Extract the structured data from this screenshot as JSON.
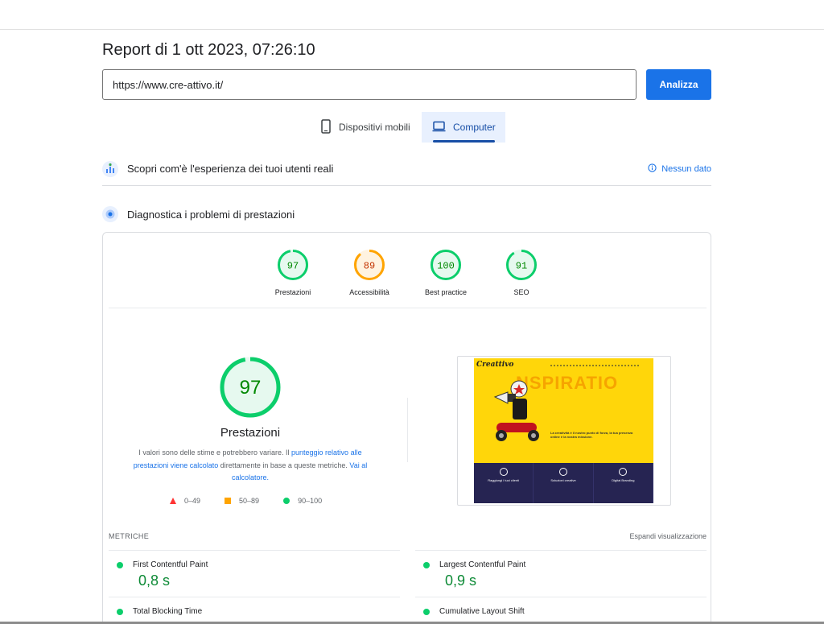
{
  "report": {
    "title": "Report di 1 ott 2023, 07:26:10"
  },
  "search": {
    "url_value": "https://www.cre-attivo.it/",
    "analyze_label": "Analizza"
  },
  "tabs": [
    {
      "label": "Dispositivi mobili",
      "icon": "smartphone-icon",
      "selected": false
    },
    {
      "label": "Computer",
      "icon": "laptop-icon",
      "selected": true
    }
  ],
  "crux": {
    "title": "Scopri com'è l'esperienza dei tuoi utenti reali",
    "no_data_label": "Nessun dato"
  },
  "diagnostics": {
    "title": "Diagnostica i problemi di prestazioni"
  },
  "scores": [
    {
      "label": "Prestazioni",
      "value": 97,
      "color": "#0cce6b",
      "text_color": "#008800"
    },
    {
      "label": "Accessibilità",
      "value": 89,
      "color": "#ffa400",
      "text_color": "#c33300"
    },
    {
      "label": "Best practice",
      "value": 100,
      "color": "#0cce6b",
      "text_color": "#008800"
    },
    {
      "label": "SEO",
      "value": 91,
      "color": "#0cce6b",
      "text_color": "#008800"
    }
  ],
  "performance": {
    "score": 97,
    "title": "Prestazioni",
    "explain_1": "I valori sono delle stime e potrebbero variare. Il ",
    "link_1": "punteggio relativo alle prestazioni viene calcolato",
    "explain_2": " direttamente in base a queste metriche. ",
    "link_2": "Vai al calcolatore.",
    "legend": [
      {
        "range": "0–49",
        "shape": "triangle",
        "color": "#ff3333"
      },
      {
        "range": "50–89",
        "shape": "square",
        "color": "#ffa400"
      },
      {
        "range": "90–100",
        "shape": "circle",
        "color": "#0cce6b"
      }
    ]
  },
  "screenshot": {
    "logo": "Creattivo",
    "headline": "NSPIRATIO",
    "tagline": "La creatività è il nostro punto di forza, la tua presenza online è la nostra missione.",
    "columns": [
      "Raggiungi i tuoi clienti",
      "Soluzioni creative",
      "Digital Branding"
    ]
  },
  "metrics": {
    "heading": "METRICHE",
    "expand_label": "Espandi visualizzazione",
    "items": [
      {
        "name": "First Contentful Paint",
        "value": "0,8 s"
      },
      {
        "name": "Largest Contentful Paint",
        "value": "0,9 s"
      },
      {
        "name": "Total Blocking Time",
        "value": ""
      },
      {
        "name": "Cumulative Layout Shift",
        "value": ""
      }
    ]
  }
}
